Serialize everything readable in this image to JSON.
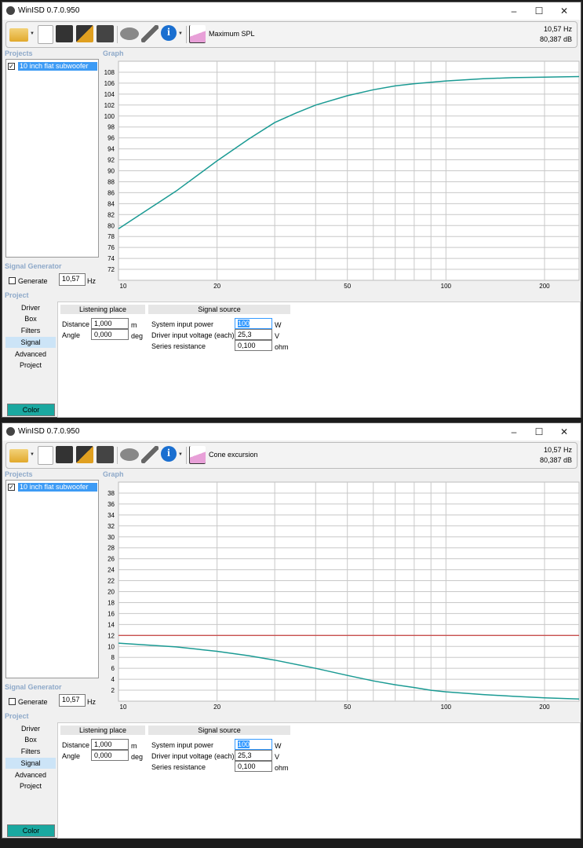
{
  "windows": [
    {
      "title": "WinISD 0.7.0.950",
      "graph_type": "Maximum SPL",
      "readout_freq": "10,57 Hz",
      "readout_level": "80,387 dB"
    },
    {
      "title": "WinISD 0.7.0.950",
      "graph_type": "Cone excursion",
      "readout_freq": "10,57 Hz",
      "readout_level": "80,387 dB"
    }
  ],
  "labels": {
    "projects": "Projects",
    "graph": "Graph",
    "signal_generator": "Signal Generator",
    "generate": "Generate",
    "project_section": "Project",
    "listening_place": "Listening place",
    "signal_source": "Signal source",
    "distance": "Distance",
    "angle": "Angle",
    "system_input_power": "System input power",
    "driver_input_voltage": "Driver input voltage (each)",
    "series_resistance": "Series resistance",
    "unit_m": "m",
    "unit_deg": "deg",
    "unit_w": "W",
    "unit_v": "V",
    "unit_ohm": "ohm",
    "unit_hz": "Hz",
    "color_button": "Color"
  },
  "values": {
    "project_name": "10 inch flat subwoofer",
    "project_checked": true,
    "generate_checked": false,
    "generator_freq": "10,57",
    "distance": "1,000",
    "angle": "0,000",
    "system_input_power": "100",
    "driver_input_voltage": "25,3",
    "series_resistance": "0,100"
  },
  "tabs": [
    {
      "label": "Driver"
    },
    {
      "label": "Box"
    },
    {
      "label": "Filters"
    },
    {
      "label": "Signal",
      "selected": true
    },
    {
      "label": "Advanced"
    },
    {
      "label": "Project"
    }
  ],
  "toolbar_icons": [
    "open-folder-icon",
    "new-project-icon",
    "save-icon",
    "save-as-icon",
    "save-all-icon",
    "driver-icon",
    "wrench-icon",
    "info-icon",
    "graph-icon"
  ],
  "colors": {
    "curve": "#1a9a93",
    "limit_line": "#c8504f",
    "color_button": "#1aa8a0",
    "selection": "#3d9bf5"
  },
  "chart_data": [
    {
      "type": "line",
      "title": "Maximum SPL",
      "x_scale": "log",
      "xlim": [
        10,
        255
      ],
      "ylim": [
        70,
        110
      ],
      "x_ticks": [
        10,
        20,
        50,
        100,
        200
      ],
      "x_grid": [
        20,
        30,
        40,
        50,
        60,
        70,
        80,
        90,
        100,
        200
      ],
      "y_ticks": [
        72,
        74,
        76,
        78,
        80,
        82,
        84,
        86,
        88,
        90,
        92,
        94,
        96,
        98,
        100,
        102,
        104,
        106,
        108
      ],
      "grid": true,
      "series": [
        {
          "x": [
            10,
            12,
            15,
            20,
            25,
            30,
            35,
            40,
            50,
            60,
            70,
            80,
            100,
            130,
            160,
            200,
            255
          ],
          "y": [
            79.4,
            82.5,
            86.3,
            91.8,
            95.8,
            98.8,
            100.6,
            102.0,
            103.7,
            104.8,
            105.5,
            105.9,
            106.4,
            106.8,
            107.0,
            107.1,
            107.2
          ]
        }
      ]
    },
    {
      "type": "line",
      "title": "Cone excursion",
      "x_scale": "log",
      "xlim": [
        10,
        255
      ],
      "ylim": [
        0,
        40
      ],
      "x_ticks": [
        10,
        20,
        50,
        100,
        200
      ],
      "x_grid": [
        20,
        30,
        40,
        50,
        60,
        70,
        80,
        90,
        100,
        200
      ],
      "y_ticks": [
        2,
        4,
        6,
        8,
        10,
        12,
        14,
        16,
        18,
        20,
        22,
        24,
        26,
        28,
        30,
        32,
        34,
        36,
        38
      ],
      "grid": true,
      "limit_line": 12,
      "series": [
        {
          "x": [
            10,
            15,
            20,
            25,
            30,
            40,
            50,
            60,
            70,
            80,
            90,
            100,
            130,
            160,
            200,
            255
          ],
          "y": [
            10.6,
            9.9,
            9.1,
            8.3,
            7.5,
            6.0,
            4.7,
            3.7,
            3.0,
            2.5,
            2.0,
            1.7,
            1.2,
            0.9,
            0.6,
            0.4
          ]
        }
      ]
    }
  ]
}
